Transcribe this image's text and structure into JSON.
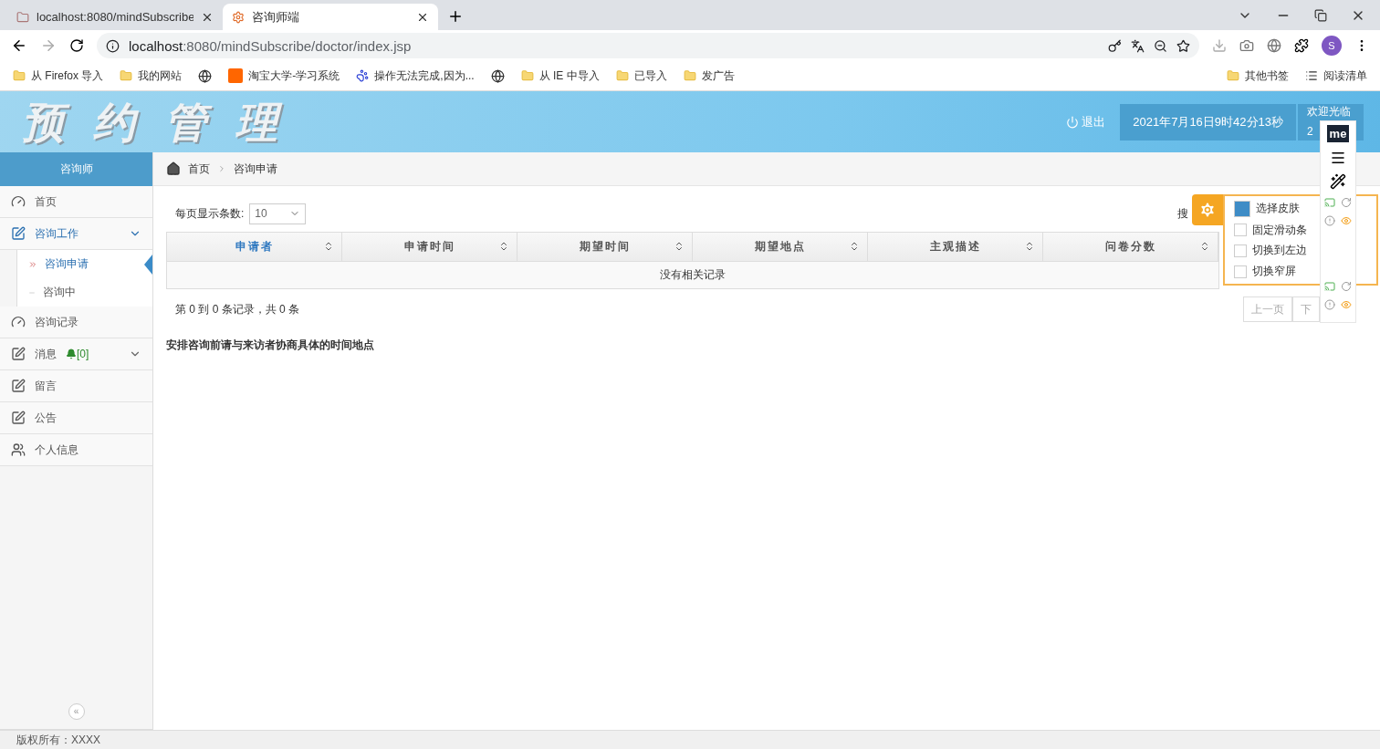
{
  "browser": {
    "tabs": [
      {
        "title": "localhost:8080/mindSubscribe",
        "selected": false
      },
      {
        "title": "咨询师端",
        "selected": true
      }
    ],
    "url_host": "localhost",
    "url_path": ":8080/mindSubscribe/doctor/index.jsp",
    "bookmarks": [
      {
        "label": "从 Firefox 导入",
        "kind": "folder"
      },
      {
        "label": "我的网站",
        "kind": "folder"
      },
      {
        "kind": "globe"
      },
      {
        "label": "淘宝大学-学习系统",
        "kind": "taobao"
      },
      {
        "label": "操作无法完成,因为...",
        "kind": "paw"
      },
      {
        "kind": "globe"
      },
      {
        "label": "从 IE 中导入",
        "kind": "folder"
      },
      {
        "label": "已导入",
        "kind": "folder"
      },
      {
        "label": "发广告",
        "kind": "folder"
      }
    ],
    "other_bookmarks": "其他书签",
    "reading_list": "阅读清单",
    "profile": "S"
  },
  "header": {
    "title": [
      "预",
      "约",
      "管",
      "理"
    ],
    "logout": "退出",
    "datetime": "2021年7月16日9时42分13秒",
    "welcome": "欢迎光临",
    "user": "2"
  },
  "sidebar": {
    "role": "咨询师",
    "collapse": "«",
    "items": [
      {
        "label": "首页",
        "selected": false
      },
      {
        "label": "咨询工作",
        "expanded": true,
        "selected": true,
        "children": [
          {
            "label": "咨询申请",
            "selected": true
          },
          {
            "label": "咨询中",
            "selected": false
          }
        ]
      },
      {
        "label": "咨询记录",
        "selected": false
      },
      {
        "label": "消息",
        "badge": "[0]",
        "expanded": false,
        "selected": false
      },
      {
        "label": "留言",
        "selected": false
      },
      {
        "label": "公告",
        "selected": false
      },
      {
        "label": "个人信息",
        "selected": false
      }
    ]
  },
  "breadcrumb": [
    "首页",
    "咨询申请"
  ],
  "page_size": {
    "label": "每页显示条数:",
    "value": "10"
  },
  "search_label": "搜",
  "table": {
    "columns": [
      {
        "label": "申请者",
        "sorted": true
      },
      {
        "label": "申请时间",
        "sorted": false
      },
      {
        "label": "期望时间",
        "sorted": false
      },
      {
        "label": "期望地点",
        "sorted": false
      },
      {
        "label": "主观描述",
        "sorted": false
      },
      {
        "label": "问卷分数",
        "sorted": false
      }
    ],
    "empty": "没有相关记录"
  },
  "summary": "第 0 到 0 条记录，共 0 条",
  "pager": [
    "上一页",
    "下"
  ],
  "note": "安排咨询前请与来访者协商具体的时间地点",
  "skin_panel": {
    "options": [
      {
        "label": "选择皮肤",
        "checked": true
      },
      {
        "label": "固定滑动条",
        "checked": false
      },
      {
        "label": "切换到左边",
        "checked": false
      },
      {
        "label": "切换窄屏",
        "checked": false
      }
    ]
  },
  "extension": {
    "badge": "me"
  },
  "footer": "版权所有：XXXX"
}
